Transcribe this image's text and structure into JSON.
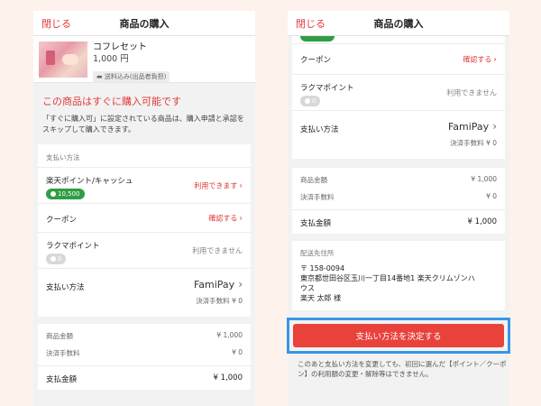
{
  "header": {
    "close": "閉じる",
    "title": "商品の購入"
  },
  "product": {
    "name": "コフレセット",
    "price": "1,000 円",
    "tag": "送料込み(出品者負担)"
  },
  "notice": {
    "title": "この商品はすぐに購入可能です",
    "body": "「すぐに購入可」に設定されている商品は、購入申請と承認をスキップして購入できます。"
  },
  "payment": {
    "section_label": "支払い方法",
    "rakuten_label": "楽天ポイント/キャッシュ",
    "rakuten_badge": "10,500",
    "rakuten_value": "利用できます",
    "coupon_label": "クーポン",
    "coupon_value": "確認する",
    "rakuma_label": "ラクマポイント",
    "rakuma_badge": "0",
    "rakuma_value": "利用できません",
    "method_label": "支払い方法",
    "method_value": "FamiPay",
    "method_fee": "決済手数料 ¥ 0"
  },
  "summary": {
    "item_label": "商品金額",
    "item_value": "¥ 1,000",
    "fee_label": "決済手数料",
    "fee_value": "¥ 0",
    "total_label": "支払金額",
    "total_value": "¥ 1,000"
  },
  "address": {
    "label": "配送先住所",
    "zip": "〒 158-0094",
    "line1": "東京都世田谷区玉川一丁目14番地1 楽天クリムゾンハ",
    "line2": "ウス",
    "name": "楽天 太郎 様"
  },
  "cta": {
    "label": "支払い方法を決定する"
  },
  "footnote": "このあと支払い方法を変更しても、初回に選んだ【ポイント／クーポン】の利用額の変更・解除等はできません。"
}
